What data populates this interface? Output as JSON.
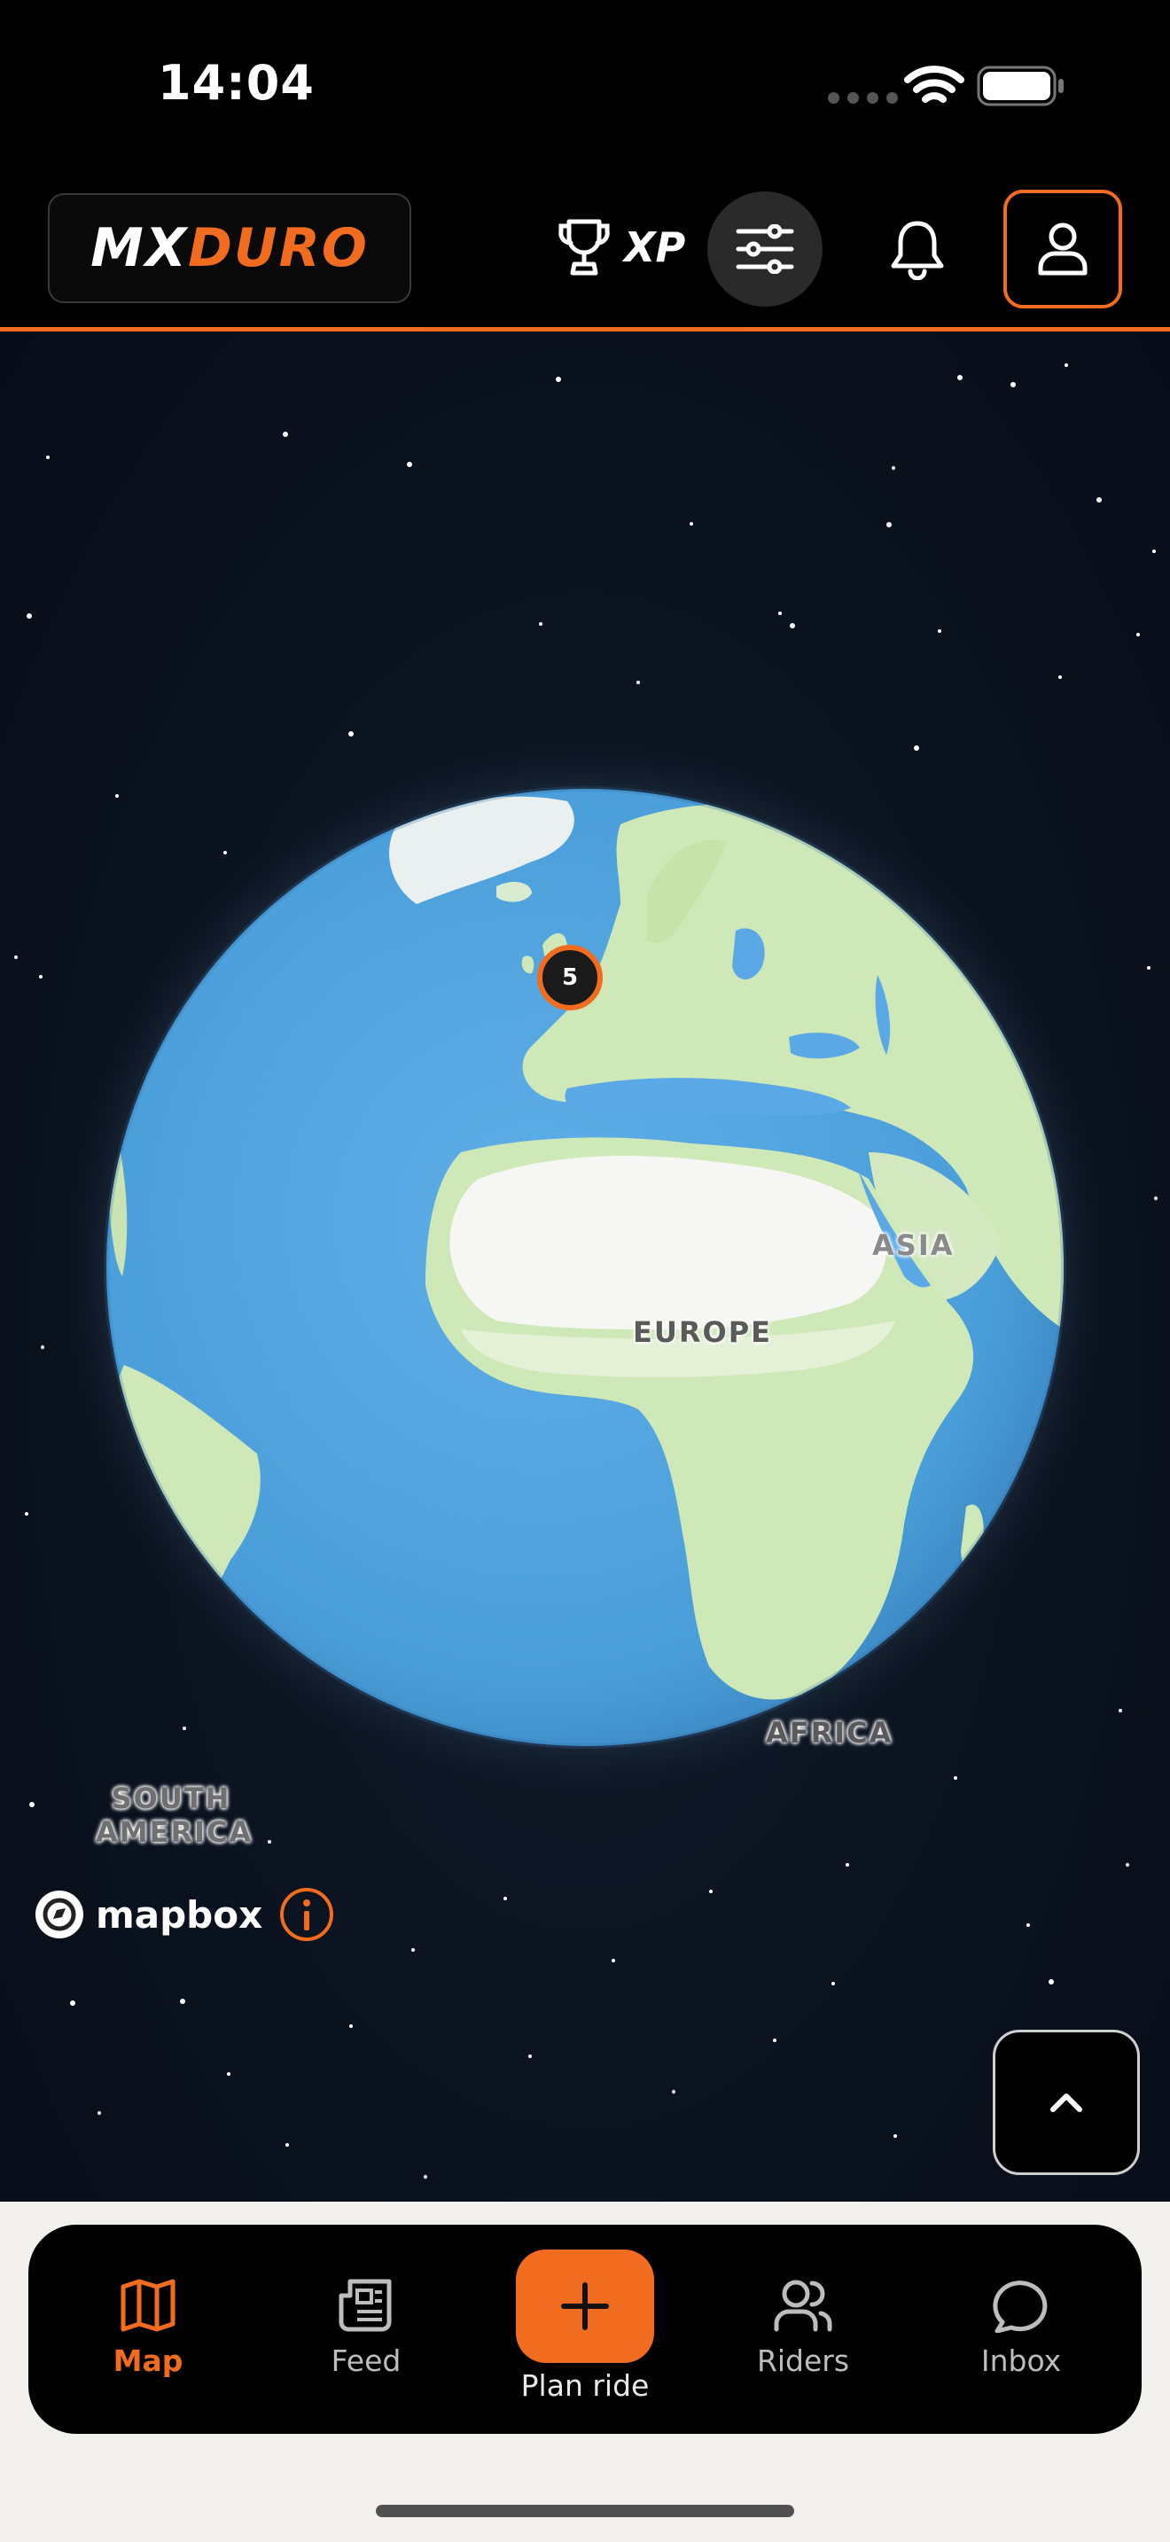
{
  "status_bar": {
    "time": "14:04"
  },
  "header": {
    "logo_part1": "MX",
    "logo_part2": "DURO",
    "xp_label": "XP"
  },
  "map": {
    "cluster_count": "5",
    "labels": {
      "europe": "EUROPE",
      "asia": "ASIA",
      "africa": "AFRICA",
      "south_america_line1": "SOUTH",
      "south_america_line2": "AMERICA"
    },
    "attribution": "mapbox"
  },
  "tabs": {
    "map": "Map",
    "feed": "Feed",
    "plan": "Plan ride",
    "riders": "Riders",
    "inbox": "Inbox"
  },
  "colors": {
    "accent": "#f26c1f",
    "ocean": "#5aa9e6",
    "land": "#cfe8b8",
    "background": "#0b1320"
  }
}
